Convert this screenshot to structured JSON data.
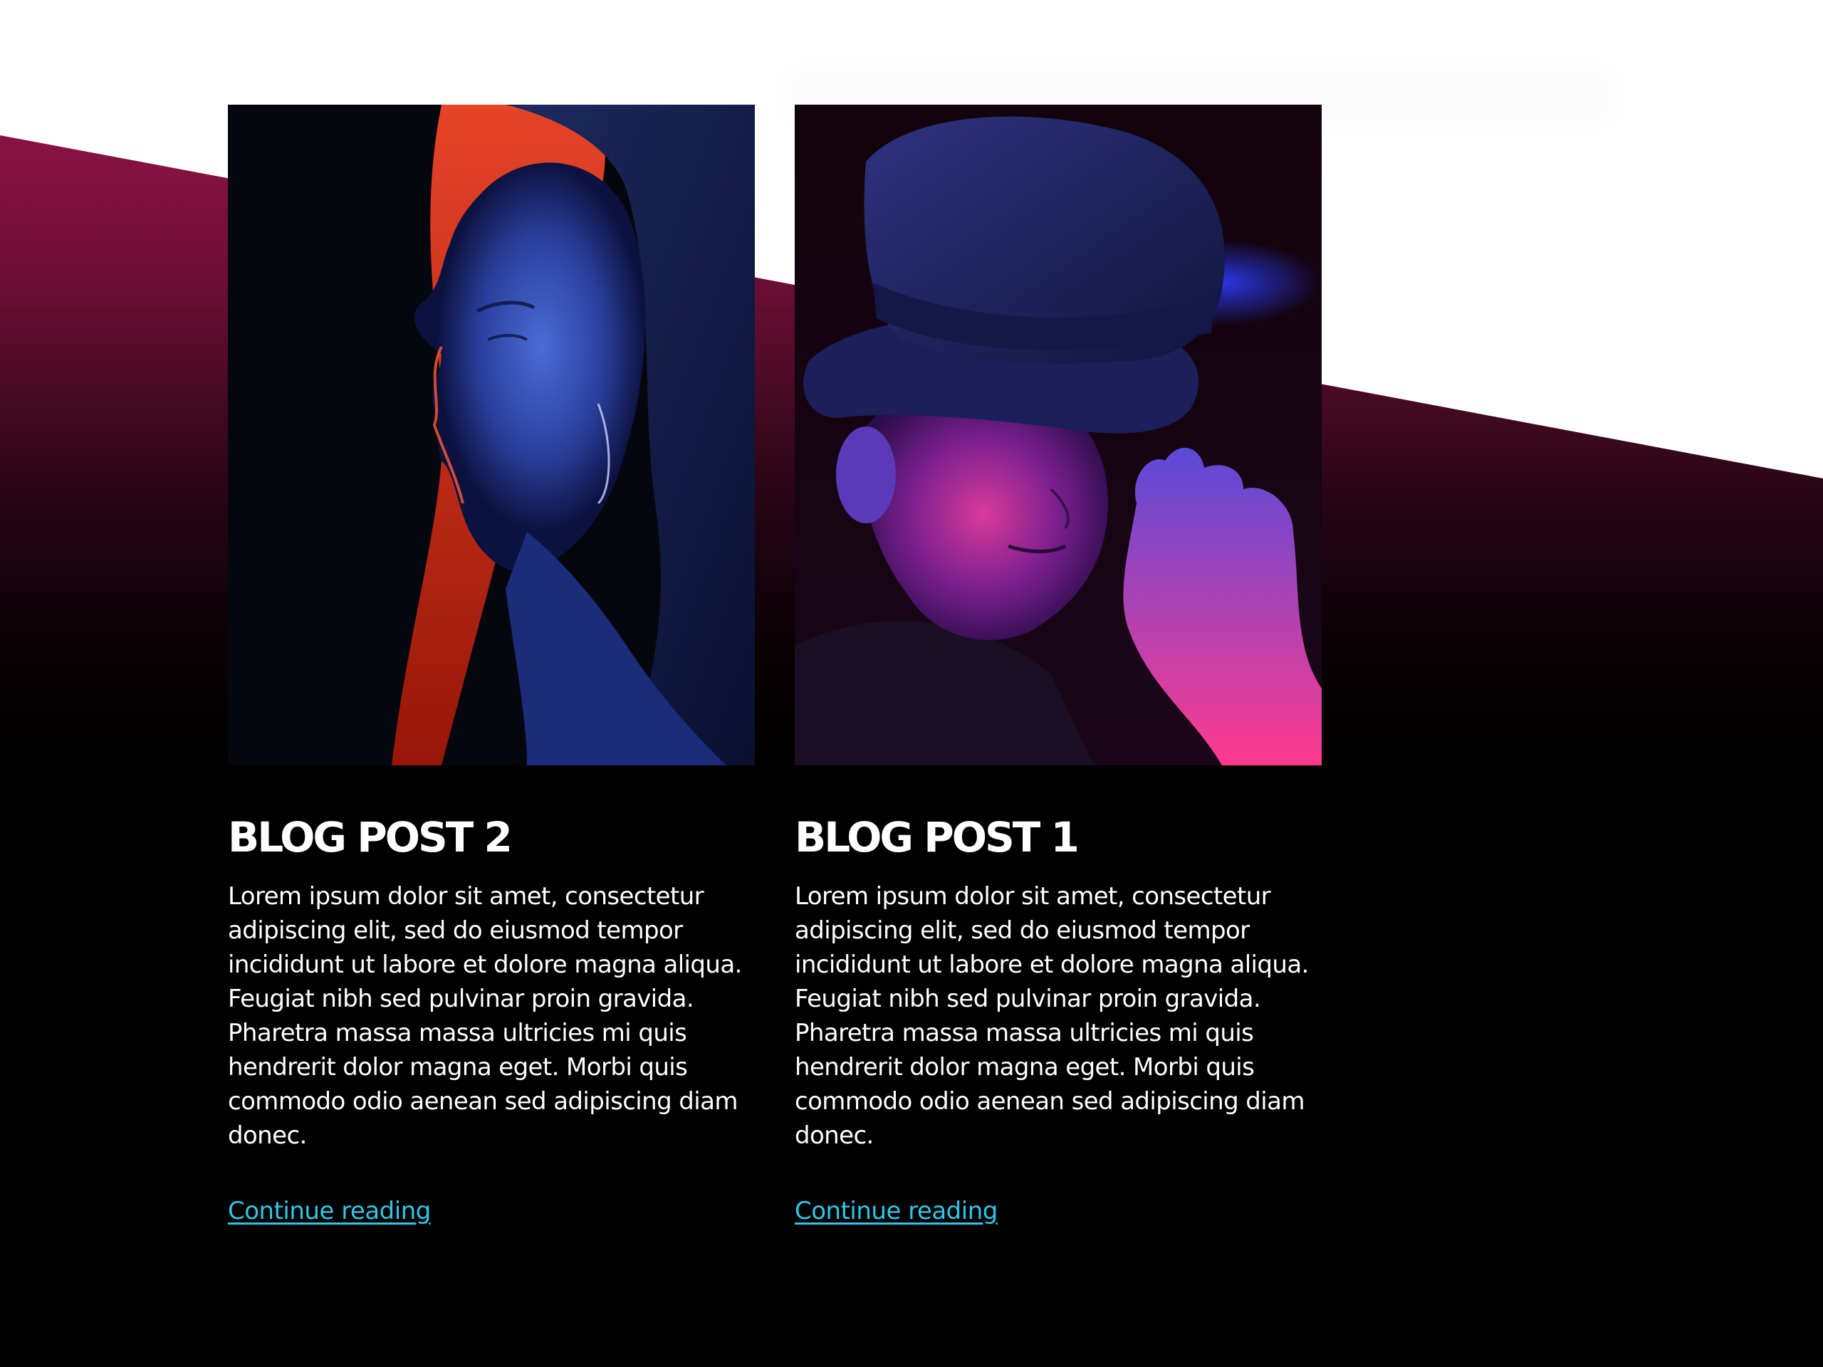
{
  "colors": {
    "accent_link": "#2ec7e8",
    "slant_band": "#a4164f",
    "background": "#000000"
  },
  "posts": [
    {
      "title": "BLOG POST 2",
      "excerpt": "Lorem ipsum dolor sit amet, consectetur adipiscing elit, sed do eiusmod tempor incididunt ut labore et dolore magna aliqua. Feugiat nibh sed pulvinar proin gravida. Pharetra massa massa ultricies mi quis hendrerit dolor magna eget. Morbi quis commodo odio aenean sed adipiscing diam donec.",
      "link_label": "Continue reading",
      "image": "woman-profile-portrait-photo"
    },
    {
      "title": "BLOG POST 1",
      "excerpt": "Lorem ipsum dolor sit amet, consectetur adipiscing elit, sed do eiusmod tempor incididunt ut labore et dolore magna aliqua. Feugiat nibh sed pulvinar proin gravida. Pharetra massa massa ultricies mi quis hendrerit dolor magna eget. Morbi quis commodo odio aenean sed adipiscing diam donec.",
      "link_label": "Continue reading",
      "image": "man-in-fedora-portrait-photo"
    }
  ]
}
